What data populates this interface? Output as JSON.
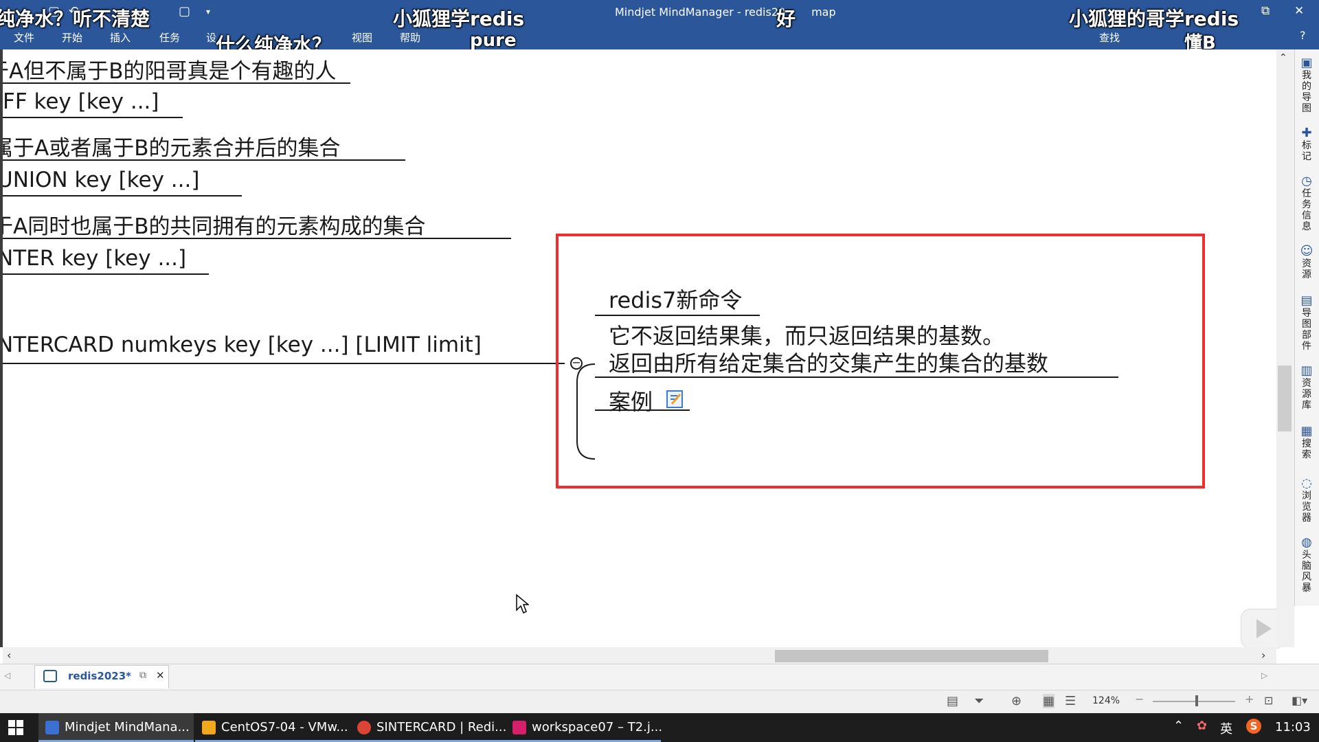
{
  "window": {
    "title": "Mindjet MindManager - redis20",
    "title_suffix": "map",
    "menu": [
      "文件",
      "开始",
      "插入",
      "任务",
      "设",
      "视图",
      "帮助",
      "查找"
    ]
  },
  "danmaku": [
    "纯净水？听不清楚",
    "小狐狸学redis",
    "pure",
    "什么纯净水？",
    "好",
    "小狐狸的哥学redis",
    "懂B"
  ],
  "topics": [
    {
      "text": "于A但不属于B的阳哥真是个有趣的人"
    },
    {
      "text": "FF key [key ...]"
    },
    {
      "text": "属于A或者属于B的元素合并后的集合"
    },
    {
      "text": "UNION key [key ...]"
    },
    {
      "text": "于A同时也属于B的共同拥有的元素构成的集合"
    },
    {
      "text": "NTER key [key ...]"
    },
    {
      "text": "NTERCARD numkeys key [key ...] [LIMIT limit]"
    }
  ],
  "subtopics": {
    "title": "redis7新命令",
    "line1": "它不返回结果集，而只返回结果的基数。",
    "line2": "返回由所有给定集合的交集产生的集合的基数",
    "example": "案例",
    "collapse_symbol": "−"
  },
  "right_panel": [
    {
      "icon": "▣",
      "label": "我的导图"
    },
    {
      "icon": "✚",
      "label": "标记"
    },
    {
      "icon": "◷",
      "label": "任务信息"
    },
    {
      "icon": "☺",
      "label": "资源"
    },
    {
      "icon": "▤",
      "label": "导图部件"
    },
    {
      "icon": "▥",
      "label": "资源库"
    },
    {
      "icon": "▦",
      "label": "搜索"
    },
    {
      "icon": "◌",
      "label": "浏览器"
    },
    {
      "icon": "◍",
      "label": "头脑风暴"
    }
  ],
  "doc_tab": {
    "label": "redis2023*"
  },
  "status": {
    "zoom": "124%"
  },
  "taskbar": {
    "items": [
      {
        "label": "Mindjet MindMana...",
        "color": "#3b6fd1"
      },
      {
        "label": "CentOS7-04 - VMw...",
        "color": "#f3a71b"
      },
      {
        "label": "SINTERCARD | Redi...",
        "color": "#db4437"
      },
      {
        "label": "workspace07 – T2.j...",
        "color": "#d61f69"
      }
    ],
    "tray_lang": "英",
    "clock": "11:03"
  }
}
